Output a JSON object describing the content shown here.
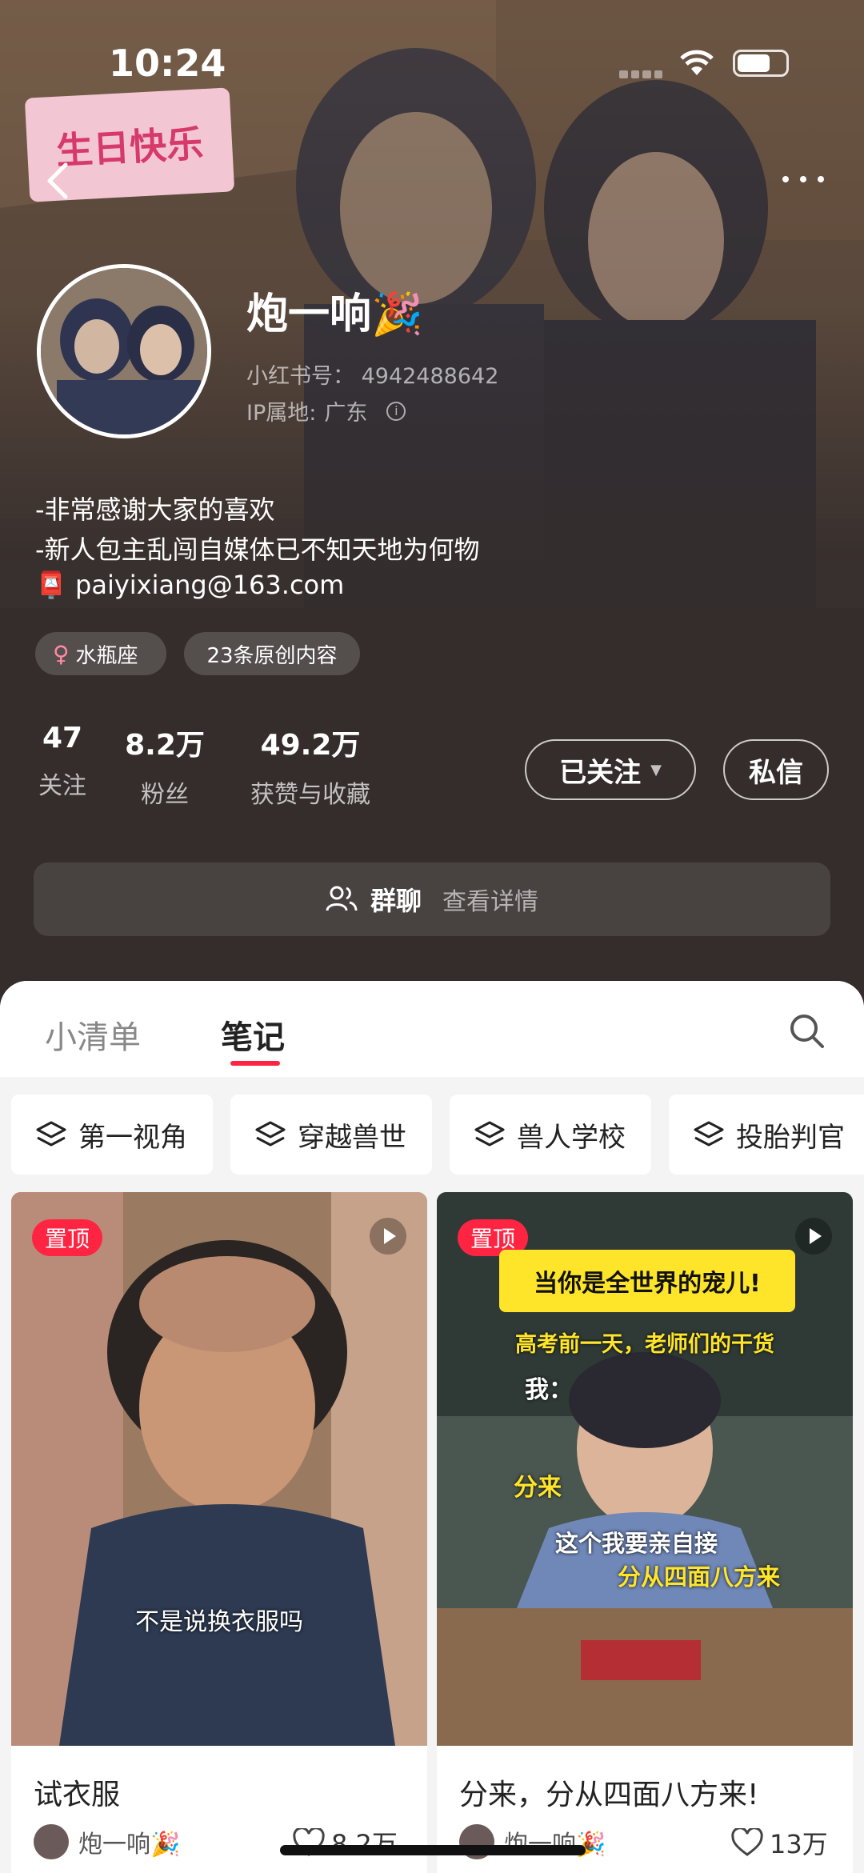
{
  "status_bar": {
    "time": "10:24"
  },
  "profile": {
    "nickname": "炮一响🎉",
    "id_label": "小红书号：",
    "id_value": "4942488642",
    "ip_label": "IP属地:",
    "ip_value": "广东",
    "bio": [
      "-非常感谢大家的喜欢",
      "-新人包主乱闯自媒体已不知天地为何物",
      "📮 paiyixiang@163.com"
    ],
    "tags": [
      {
        "icon": "female-icon",
        "label": "水瓶座"
      },
      {
        "label": "23条原创内容"
      }
    ]
  },
  "stats": [
    {
      "num": "47",
      "label": "关注"
    },
    {
      "num": "8.2万",
      "label": "粉丝"
    },
    {
      "num": "49.2万",
      "label": "获赞与收藏"
    }
  ],
  "actions": {
    "follow_label": "已关注",
    "message_label": "私信"
  },
  "group_chat": {
    "label": "群聊",
    "detail": "查看详情"
  },
  "tabs": [
    {
      "label": "小清单",
      "active": false
    },
    {
      "label": "笔记",
      "active": true
    }
  ],
  "collections": [
    {
      "label": "第一视角"
    },
    {
      "label": "穿越兽世"
    },
    {
      "label": "兽人学校"
    },
    {
      "label": "投胎判官"
    }
  ],
  "notes": [
    {
      "pinned": "置顶",
      "caption": "不是说换衣服吗",
      "title": "试衣服",
      "author": "炮一响🎉",
      "likes": "8.2万"
    },
    {
      "pinned": "置顶",
      "overlay": [
        "当你是全世界的宠儿!",
        "高考前一天，老师们的干货",
        "我：",
        "分来",
        "这个我要亲自接",
        "分从四面八方来"
      ],
      "title": "分来，分从四面八方来!",
      "author": "炮一响🎉",
      "likes": "13万"
    }
  ],
  "birthday_sign": "生日快乐",
  "colors": {
    "accent": "#ff2442",
    "header_bg": "#342d2c",
    "sheet_bg": "#f4f4f4"
  }
}
